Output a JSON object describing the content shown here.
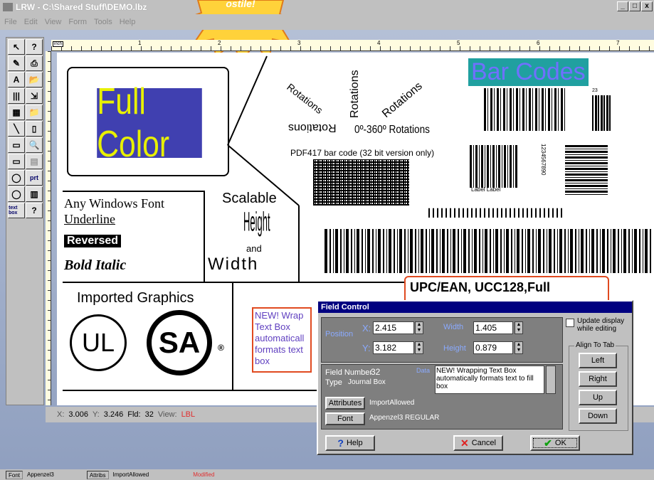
{
  "window": {
    "title": "LRW - C:\\Shared Stuff\\DEMO.lbz",
    "minimize": "_",
    "maximize": "□",
    "close": "x"
  },
  "badge": {
    "text": "ostile!"
  },
  "menu": [
    "File",
    "Edit",
    "View",
    "Form",
    "Tools",
    "Help"
  ],
  "tools": {
    "text": "A",
    "prt": "prt",
    "textbox": "text box",
    "help": "?"
  },
  "ruler": {
    "unit": "inch",
    "ticks": [
      "1",
      "2",
      "3",
      "4",
      "5",
      "6",
      "7"
    ]
  },
  "canvas": {
    "full_color": "Full Color",
    "windows_font": "Any Windows Font",
    "underline": "Underline",
    "reversed": "Reversed",
    "bold_italic": "Bold Italic",
    "scalable": "Scalable",
    "height": "Height",
    "and": "and",
    "width": "Width",
    "imported": "Imported Graphics",
    "ul": "UL",
    "sa": "SA",
    "rot1": "Rotations",
    "rot2": "Rotations",
    "rot3": "Rotations",
    "rot4": "Rotations",
    "rot_range": "0º-360º Rotations",
    "barcodes": "Bar Codes",
    "pdf417": "PDF417 bar code (32 bit version only)",
    "label1": "Label Label",
    "bc_num_small": "23",
    "bc_vertical_num": "1234567890",
    "upc": "UPC/EAN, UCC128,Full",
    "new_text": "NEW! Wrap Text Box automaticall formats text box"
  },
  "status": {
    "x_label": "X:",
    "x": "3.006",
    "y_label": "Y:",
    "y": "3.246",
    "fld_label": "Fld:",
    "fld": "32",
    "view_label": "View:",
    "view": "LBL"
  },
  "bottom": {
    "font_label": "Font",
    "font": "Appenzel3",
    "attr_label": "Attribs",
    "attr": "ImportAllowed",
    "modified": "Modified"
  },
  "dialog": {
    "title": "Field Control",
    "position_label": "Position",
    "x_label": "X:",
    "x": "2.415",
    "y_label": "Y:",
    "y": "3.182",
    "width_label": "Width",
    "width": "1.405",
    "height_label": "Height",
    "height": "0.879",
    "field_number_label": "Field Number",
    "field_number": "32",
    "type_label": "Type",
    "type": "Journal Box",
    "data_label": "Data",
    "data": "NEW! Wrapping Text Box automatically formats text to fill box",
    "attributes_button": "Attributes",
    "attributes": "ImportAllowed",
    "font_button": "Font",
    "font": "Appenzel3 REGULAR",
    "update_display": "Update display while editing",
    "align_tab": "Align To Tab",
    "left": "Left",
    "right": "Right",
    "up": "Up",
    "down": "Down",
    "help": "Help",
    "cancel": "Cancel",
    "ok": "OK"
  }
}
